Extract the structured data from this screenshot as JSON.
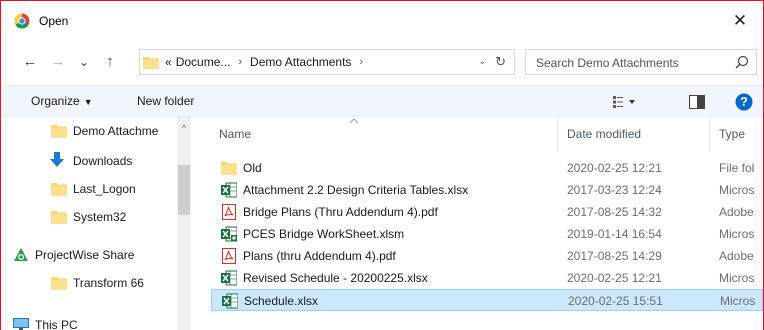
{
  "window": {
    "title": "Open",
    "close_glyph": "✕",
    "app_icon": "chrome-icon"
  },
  "nav": {
    "back_glyph": "←",
    "forward_glyph": "→",
    "recent_glyph": "⌄",
    "up_glyph": "↑"
  },
  "address": {
    "overflow": "«",
    "crumbs": [
      "Docume...",
      "Demo Attachments"
    ],
    "separator": "›",
    "dropdown_glyph": "⌄",
    "refresh_glyph": "↻"
  },
  "search": {
    "placeholder": "Search Demo Attachments"
  },
  "toolbar": {
    "organize_label": "Organize",
    "organize_caret": "▼",
    "new_folder_label": "New folder",
    "view_caret": "▼",
    "help_glyph": "?"
  },
  "sidebar": {
    "items": [
      {
        "label": "Demo Attachme",
        "icon": "folder-icon"
      },
      {
        "label": "Downloads",
        "icon": "download-icon"
      },
      {
        "label": "Last_Logon",
        "icon": "folder-icon"
      },
      {
        "label": "System32",
        "icon": "folder-icon"
      },
      {
        "label": "ProjectWise Share",
        "icon": "projectwise-icon"
      },
      {
        "label": "Transform 66",
        "icon": "folder-icon"
      },
      {
        "label": "This PC",
        "icon": "computer-icon"
      }
    ],
    "scroll_up_glyph": "^"
  },
  "columns": {
    "name": "Name",
    "date": "Date modified",
    "type": "Type"
  },
  "files": [
    {
      "name": "Old",
      "date": "2020-02-25 12:21",
      "type": "File fol",
      "icon": "folder-icon"
    },
    {
      "name": "Attachment 2.2 Design Criteria Tables.xlsx",
      "date": "2017-03-23 12:24",
      "type": "Micros",
      "icon": "excel-icon"
    },
    {
      "name": "Bridge Plans (Thru Addendum 4).pdf",
      "date": "2017-08-25 14:32",
      "type": "Adobe",
      "icon": "pdf-icon"
    },
    {
      "name": "PCES Bridge WorkSheet.xlsm",
      "date": "2019-01-14 16:54",
      "type": "Micros",
      "icon": "excel-macro-icon"
    },
    {
      "name": "Plans (thru Addendum 4).pdf",
      "date": "2017-08-25 14:29",
      "type": "Adobe",
      "icon": "pdf-icon"
    },
    {
      "name": "Revised Schedule - 20200225.xlsx",
      "date": "2020-02-25 12:21",
      "type": "Micros",
      "icon": "excel-icon"
    },
    {
      "name": "Schedule.xlsx",
      "date": "2020-02-25 15:51",
      "type": "Micros",
      "icon": "excel-icon",
      "selected": true
    }
  ],
  "colors": {
    "accent": "#0078d7",
    "selection": "#cce8ff",
    "folder": "#f8d775",
    "excel": "#1d6f42",
    "pdf": "#d9302b",
    "window_border": "#e81123"
  }
}
